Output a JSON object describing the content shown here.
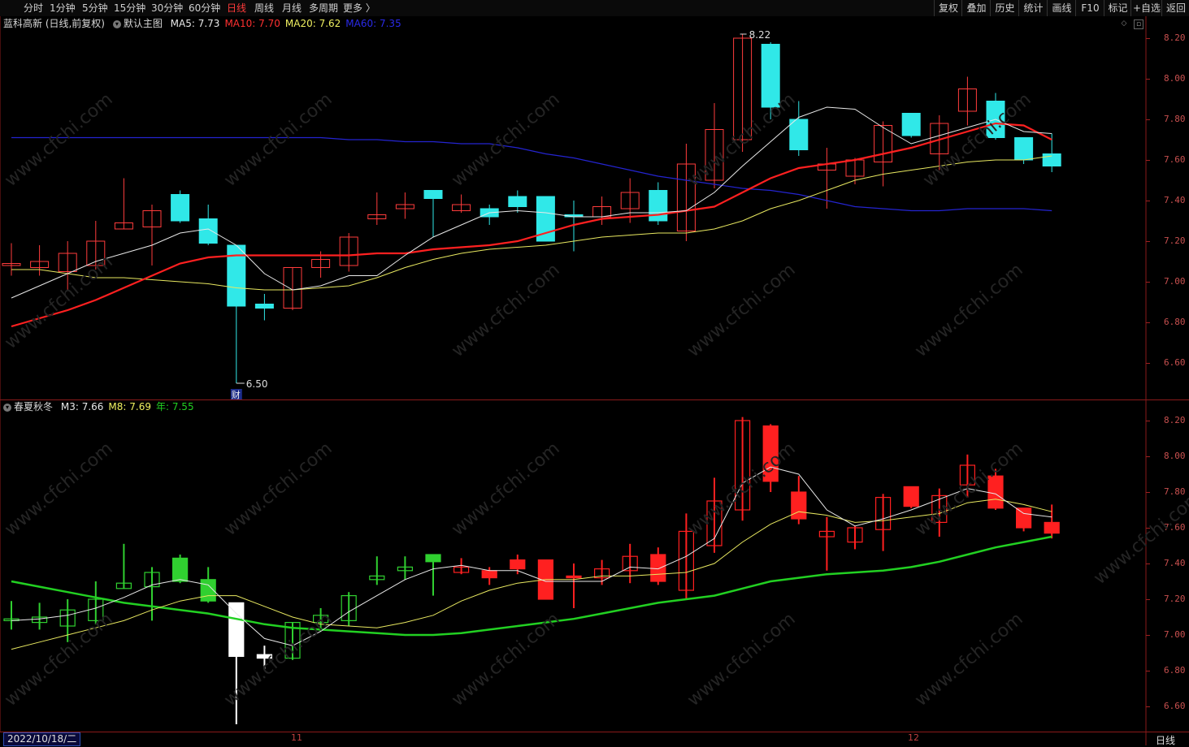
{
  "periods": [
    "分时",
    "1分钟",
    "5分钟",
    "15分钟",
    "30分钟",
    "60分钟",
    "日线",
    "周线",
    "月线",
    "多周期",
    "更多 〉"
  ],
  "active_period": "日线",
  "tools": [
    "复权",
    "叠加",
    "历史",
    "统计",
    "画线",
    "F10",
    "标记",
    "+自选",
    "返回"
  ],
  "main_header": {
    "stock": "蓝科高新 (日线,前复权)",
    "indicator": "默认主图",
    "ma": [
      {
        "label": "MA5: 7.73",
        "color": "#e8e8e8"
      },
      {
        "label": "MA10: 7.70",
        "color": "#ff3030"
      },
      {
        "label": "MA20: 7.62",
        "color": "#f0f060"
      },
      {
        "label": "MA60: 7.35",
        "color": "#2a2ae8"
      }
    ]
  },
  "sub_header": {
    "indicator": "春夏秋冬",
    "lines": [
      {
        "label": "M3: 7.66",
        "color": "#e8e8e8"
      },
      {
        "label": "M8: 7.69",
        "color": "#f0f060"
      },
      {
        "label": "年: 7.55",
        "color": "#22d022"
      }
    ]
  },
  "main_axis": [
    "8.20",
    "8.00",
    "7.80",
    "7.60",
    "7.40",
    "7.20",
    "7.00",
    "6.80",
    "6.60"
  ],
  "sub_axis": [
    "8.20",
    "8.00",
    "7.80",
    "7.60",
    "7.40",
    "7.20",
    "7.00",
    "6.80",
    "6.60"
  ],
  "high_label": "8.22",
  "low_label": "6.50",
  "fin_badge": "财",
  "bottom": {
    "date": "2022/10/18/二",
    "month_11": "11",
    "month_12": "12",
    "period": "日线"
  },
  "watermark": "www.cfchi.com",
  "candles": [
    [
      7.08,
      7.19,
      7.03,
      7.09
    ],
    [
      7.07,
      7.18,
      7.03,
      7.1
    ],
    [
      7.05,
      7.2,
      6.96,
      7.14
    ],
    [
      7.08,
      7.3,
      7.06,
      7.2
    ],
    [
      7.26,
      7.51,
      7.26,
      7.29
    ],
    [
      7.27,
      7.38,
      7.08,
      7.35
    ],
    [
      7.43,
      7.45,
      7.29,
      7.3
    ],
    [
      7.31,
      7.38,
      7.18,
      7.19
    ],
    [
      7.18,
      7.18,
      6.5,
      6.88
    ],
    [
      6.89,
      6.94,
      6.81,
      6.87
    ],
    [
      6.87,
      7.07,
      6.86,
      7.07
    ],
    [
      7.07,
      7.15,
      7.02,
      7.11
    ],
    [
      7.08,
      7.24,
      7.05,
      7.22
    ],
    [
      7.31,
      7.44,
      7.28,
      7.33
    ],
    [
      7.36,
      7.44,
      7.31,
      7.38
    ],
    [
      7.45,
      7.45,
      7.22,
      7.41
    ],
    [
      7.35,
      7.43,
      7.34,
      7.38
    ],
    [
      7.36,
      7.38,
      7.28,
      7.32
    ],
    [
      7.42,
      7.45,
      7.34,
      7.37
    ],
    [
      7.42,
      7.42,
      7.2,
      7.2
    ],
    [
      7.33,
      7.4,
      7.15,
      7.32
    ],
    [
      7.32,
      7.42,
      7.28,
      7.37
    ],
    [
      7.36,
      7.51,
      7.29,
      7.44
    ],
    [
      7.45,
      7.49,
      7.28,
      7.3
    ],
    [
      7.25,
      7.68,
      7.2,
      7.58
    ],
    [
      7.5,
      7.88,
      7.46,
      7.75
    ],
    [
      7.7,
      8.22,
      7.64,
      8.2
    ],
    [
      8.17,
      8.18,
      7.8,
      7.86
    ],
    [
      7.8,
      7.89,
      7.62,
      7.65
    ],
    [
      7.55,
      7.66,
      7.36,
      7.58
    ],
    [
      7.52,
      7.61,
      7.48,
      7.6
    ],
    [
      7.59,
      7.79,
      7.47,
      7.77
    ],
    [
      7.83,
      7.83,
      7.71,
      7.72
    ],
    [
      7.63,
      7.82,
      7.55,
      7.78
    ],
    [
      7.84,
      8.01,
      7.77,
      7.95
    ],
    [
      7.89,
      7.93,
      7.7,
      7.71
    ],
    [
      7.71,
      7.71,
      7.58,
      7.6
    ],
    [
      7.63,
      7.73,
      7.54,
      7.57
    ]
  ],
  "ma_main": {
    "ma5": [
      6.92,
      6.98,
      7.04,
      7.1,
      7.14,
      7.18,
      7.24,
      7.26,
      7.18,
      7.04,
      6.96,
      6.98,
      7.03,
      7.03,
      7.13,
      7.22,
      7.28,
      7.34,
      7.35,
      7.34,
      7.32,
      7.32,
      7.34,
      7.34,
      7.35,
      7.44,
      7.57,
      7.69,
      7.81,
      7.86,
      7.85,
      7.76,
      7.68,
      7.72,
      7.76,
      7.8,
      7.74,
      7.73
    ],
    "ma10": [
      6.78,
      6.82,
      6.86,
      6.91,
      6.97,
      7.03,
      7.09,
      7.12,
      7.13,
      7.13,
      7.13,
      7.13,
      7.13,
      7.14,
      7.14,
      7.16,
      7.17,
      7.18,
      7.2,
      7.24,
      7.28,
      7.31,
      7.32,
      7.33,
      7.35,
      7.37,
      7.44,
      7.51,
      7.56,
      7.58,
      7.6,
      7.63,
      7.66,
      7.7,
      7.74,
      7.78,
      7.77,
      7.7
    ],
    "ma20": [
      7.06,
      7.06,
      7.04,
      7.02,
      7.02,
      7.01,
      7.0,
      6.99,
      6.97,
      6.96,
      6.96,
      6.97,
      6.98,
      7.02,
      7.07,
      7.11,
      7.14,
      7.16,
      7.17,
      7.18,
      7.2,
      7.22,
      7.23,
      7.24,
      7.24,
      7.26,
      7.3,
      7.36,
      7.4,
      7.45,
      7.5,
      7.53,
      7.55,
      7.57,
      7.59,
      7.6,
      7.6,
      7.62
    ],
    "ma60": [
      7.71,
      7.71,
      7.71,
      7.71,
      7.71,
      7.71,
      7.71,
      7.71,
      7.71,
      7.71,
      7.71,
      7.71,
      7.7,
      7.7,
      7.69,
      7.69,
      7.68,
      7.68,
      7.66,
      7.63,
      7.61,
      7.58,
      7.55,
      7.52,
      7.5,
      7.48,
      7.46,
      7.45,
      7.43,
      7.4,
      7.37,
      7.36,
      7.35,
      7.35,
      7.36,
      7.36,
      7.36,
      7.35
    ]
  },
  "sub_lines": {
    "m3": [
      7.08,
      7.09,
      7.11,
      7.15,
      7.21,
      7.28,
      7.31,
      7.28,
      7.12,
      6.98,
      6.94,
      7.02,
      7.13,
      7.22,
      7.31,
      7.37,
      7.39,
      7.36,
      7.36,
      7.3,
      7.3,
      7.3,
      7.38,
      7.37,
      7.44,
      7.54,
      7.85,
      7.94,
      7.9,
      7.7,
      7.61,
      7.65,
      7.7,
      7.76,
      7.82,
      7.79,
      7.68,
      7.66
    ],
    "m8": [
      6.92,
      6.96,
      7.0,
      7.04,
      7.08,
      7.14,
      7.19,
      7.22,
      7.22,
      7.16,
      7.1,
      7.06,
      7.05,
      7.04,
      7.07,
      7.11,
      7.19,
      7.25,
      7.29,
      7.31,
      7.31,
      7.33,
      7.33,
      7.34,
      7.35,
      7.4,
      7.52,
      7.62,
      7.69,
      7.67,
      7.63,
      7.64,
      7.66,
      7.68,
      7.74,
      7.76,
      7.73,
      7.69
    ],
    "year": [
      7.3,
      7.27,
      7.24,
      7.21,
      7.18,
      7.16,
      7.14,
      7.12,
      7.09,
      7.06,
      7.04,
      7.03,
      7.02,
      7.01,
      7.0,
      7.0,
      7.01,
      7.03,
      7.05,
      7.07,
      7.09,
      7.12,
      7.15,
      7.18,
      7.2,
      7.22,
      7.26,
      7.3,
      7.32,
      7.34,
      7.35,
      7.36,
      7.38,
      7.41,
      7.45,
      7.49,
      7.52,
      7.55
    ]
  }
}
